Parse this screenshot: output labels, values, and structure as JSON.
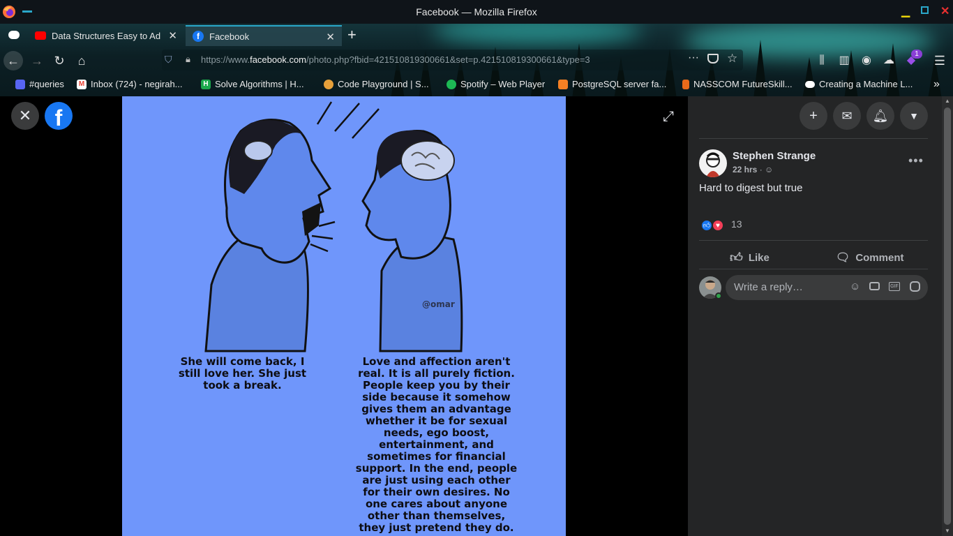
{
  "window": {
    "title": "Facebook — Mozilla Firefox"
  },
  "tabs": [
    {
      "label": "Data Structures Easy to Ad",
      "icon": "youtube-icon"
    },
    {
      "label": "Facebook",
      "icon": "facebook-icon"
    }
  ],
  "url": {
    "prefix": "https://www.",
    "host": "facebook.com",
    "path": "/photo.php?fbid=421510819300661&set=p.421510819300661&type=3"
  },
  "bookmarks": [
    {
      "label": "#queries",
      "icon": "discord-icon",
      "color": "#5865f2"
    },
    {
      "label": "Inbox (724) - negirah...",
      "icon": "gmail-icon",
      "color": "#ea4335"
    },
    {
      "label": "Solve Algorithms | H...",
      "icon": "hackerrank-icon",
      "color": "#1ba94c"
    },
    {
      "label": "Code Playground | S...",
      "icon": "sololearn-icon",
      "color": "#e7a03a"
    },
    {
      "label": "Spotify – Web Player",
      "icon": "spotify-icon",
      "color": "#1db954"
    },
    {
      "label": "PostgreSQL server fa...",
      "icon": "stackoverflow-icon",
      "color": "#f48024"
    },
    {
      "label": "NASSCOM FutureSkill...",
      "icon": "nasscom-icon",
      "color": "#e86a1a"
    },
    {
      "label": "Creating a Machine L...",
      "icon": "medium-icon",
      "color": "#ffffff"
    }
  ],
  "extensions": {
    "badge": "1"
  },
  "photo": {
    "left_caption": "She will come back, I still love her. She just took a break.",
    "right_caption": "Love and affection aren't real. It is all purely fiction. People keep you by their side because it somehow gives them an advantage whether it be for sexual needs, ego boost, entertainment, and sometimes for financial support. In the end, people are just using each other for their own desires. No one cares about anyone other than themselves, they just pretend they do.",
    "watermark": "@omar"
  },
  "post": {
    "author": "Stephen Strange",
    "time": "22 hrs",
    "separator": "·",
    "text": "Hard to digest but true",
    "reaction_count": "13",
    "like_label": "Like",
    "comment_label": "Comment",
    "reply_placeholder": "Write a reply…"
  },
  "colors": {
    "fb_blue": "#1877f2",
    "panel_bg": "#242526",
    "photo_bg": "#6f96fb"
  }
}
